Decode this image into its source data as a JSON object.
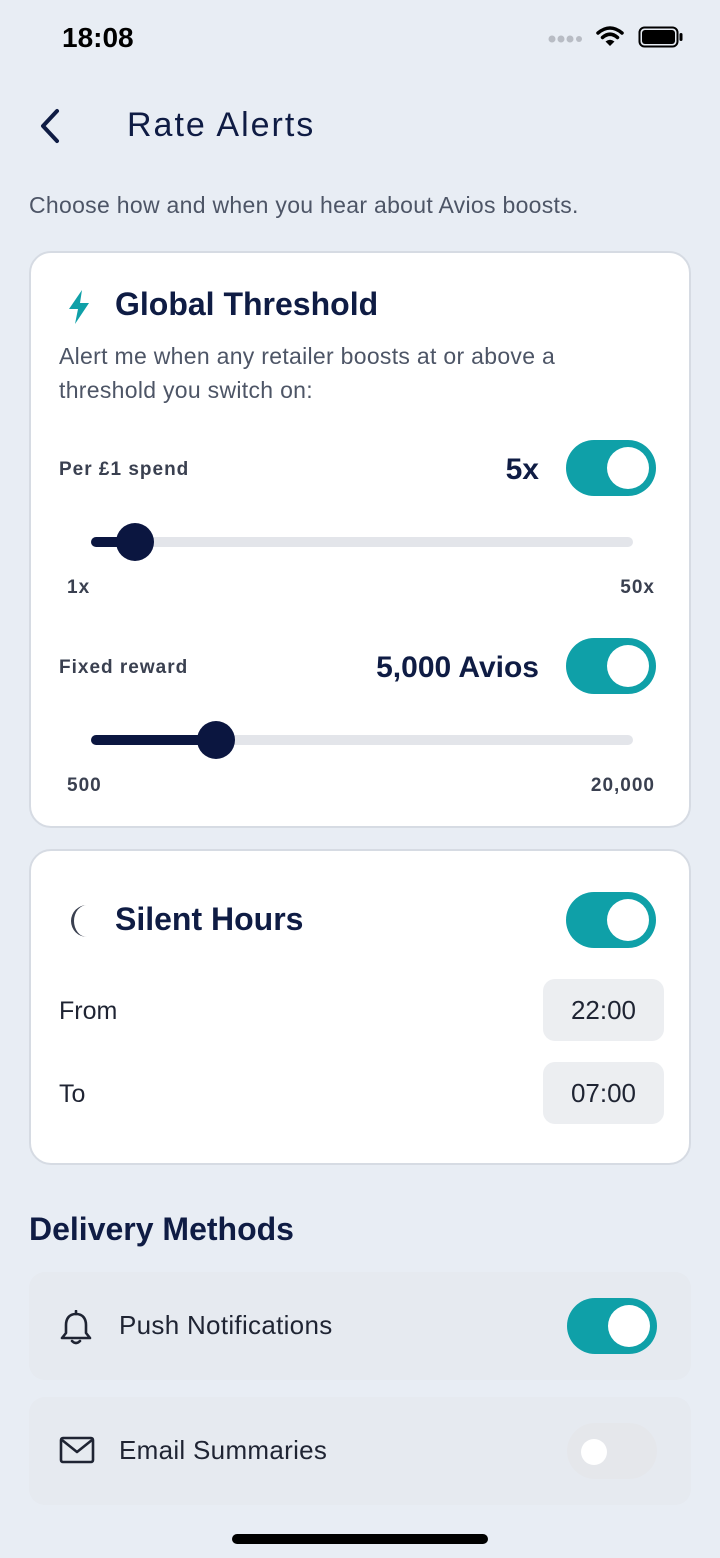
{
  "status_bar": {
    "time": "18:08",
    "icons": [
      "signal-icon",
      "wifi-icon",
      "battery-icon"
    ]
  },
  "header": {
    "title": "Rate Alerts",
    "back_icon": "chevron-left-icon"
  },
  "intro_text": "Choose how and when you hear about Avios boosts.",
  "global_threshold": {
    "icon": "bolt-icon",
    "title": "Global Threshold",
    "description": "Alert me when any retailer boosts at or above a threshold you switch on:",
    "per_spend": {
      "label": "Per £1 spend",
      "value_label": "5x",
      "enabled": true,
      "min_label": "1x",
      "max_label": "50x",
      "fraction": 0.082
    },
    "fixed_reward": {
      "label": "Fixed reward",
      "value_label": "5,000 Avios",
      "enabled": true,
      "min_label": "500",
      "max_label": "20,000",
      "fraction": 0.231
    }
  },
  "silent_hours": {
    "icon": "moon-icon",
    "title": "Silent Hours",
    "enabled": true,
    "from_label": "From",
    "from_value": "22:00",
    "to_label": "To",
    "to_value": "07:00"
  },
  "delivery_methods": {
    "title": "Delivery Methods",
    "items": [
      {
        "icon": "bell-icon",
        "label": "Push Notifications",
        "enabled": true
      },
      {
        "icon": "mail-icon",
        "label": "Email Summaries",
        "enabled": false
      }
    ]
  },
  "colors": {
    "accent": "#0fa0a8",
    "navy": "#0f1c44",
    "background": "#e8edf4"
  }
}
